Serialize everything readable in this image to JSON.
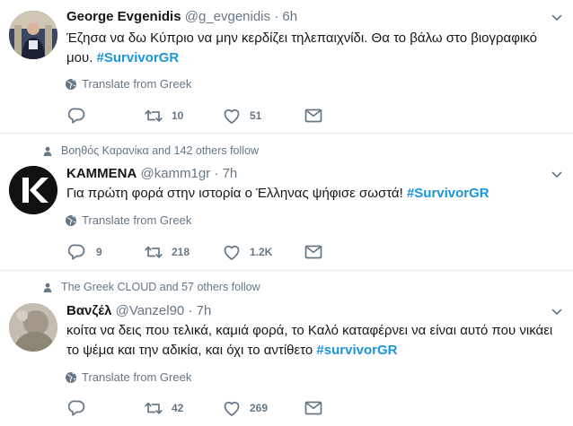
{
  "tweets": [
    {
      "name": "George Evgenidis",
      "handle": "@g_evgenidis",
      "dot": "·",
      "time": "6h",
      "text_line1": "Έζησα να δω Κύπριο να μην κερδίζει τηλεπαιχνίδι. Θα το βάλω στο βιογραφικό",
      "text_line2_prefix": "μου. ",
      "hashtag": "#SurvivorGR",
      "translate": "Translate from Greek",
      "reply_count": "",
      "retweet_count": "10",
      "like_count": "51"
    },
    {
      "social_context": "Βοηθός Καρανίκα and 142 others follow",
      "name": "ΚΑΜΜΕΝΑ",
      "handle": "@kamm1gr",
      "dot": "·",
      "time": "7h",
      "text_line1_prefix": "Για πρώτη φορά στην ιστορία ο Έλληνας ψήφισε σωστά! ",
      "hashtag": "#SurvivorGR",
      "translate": "Translate from Greek",
      "avatar_letter": "K",
      "reply_count": "9",
      "retweet_count": "218",
      "like_count": "1.2K"
    },
    {
      "social_context": "The Greek CLOUD and 57 others follow",
      "name": "Βανζέλ",
      "handle": "@Vanzel90",
      "dot": "·",
      "time": "7h",
      "text_line1": "κοίτα να δεις που τελικά, καμιά φορά, το Καλό καταφέρνει να είναι αυτό που νικάει",
      "text_line2_prefix": "το ψέμα και την αδικία, και όχι το αντίθετο ",
      "hashtag": "#survivorGR",
      "translate": "Translate from Greek",
      "reply_count": "",
      "retweet_count": "42",
      "like_count": "269"
    }
  ],
  "colors": {
    "accent": "#1b95e0",
    "muted": "#657786",
    "text": "#14171a",
    "divider": "#e6ecf0"
  },
  "icons": [
    "chevron-down-icon",
    "globe-icon",
    "reply-icon",
    "retweet-icon",
    "heart-icon",
    "mail-icon",
    "person-icon"
  ]
}
